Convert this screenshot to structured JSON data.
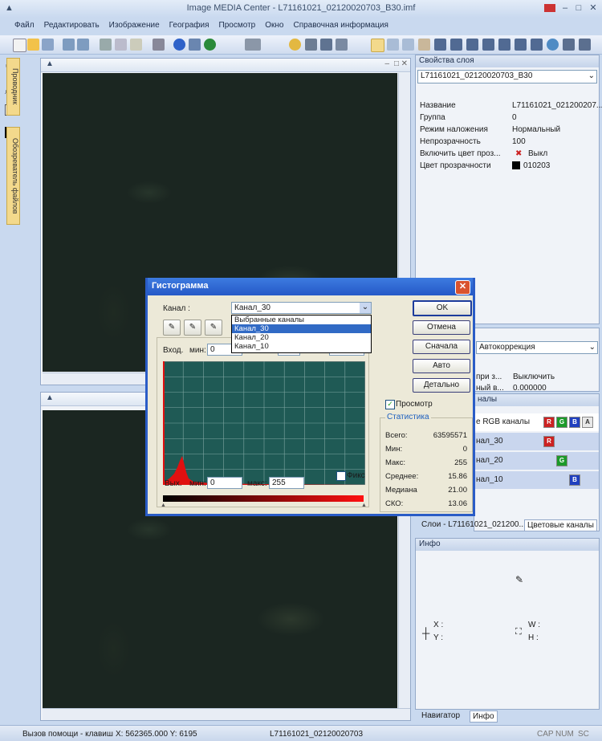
{
  "window": {
    "title": "Image MEDIA Center - L71161021_02120020703_B30.imf"
  },
  "menu": [
    "Файл",
    "Редактировать",
    "Изображение",
    "География",
    "Просмотр",
    "Окно",
    "Справочная информация"
  ],
  "left_tabs": [
    "Проводник",
    "Обозреватель файлов"
  ],
  "layer_props": {
    "title": "Свойства слоя",
    "layer_select": "L71161021_02120020703_B30",
    "rows": [
      {
        "key": "Название",
        "value": "L71161021_021200207..."
      },
      {
        "key": "Группа",
        "value": "0"
      },
      {
        "key": "Режим наложения",
        "value": "Нормальный"
      },
      {
        "key": "Непрозрачность",
        "value": "100"
      },
      {
        "key": "Включить цвет проз...",
        "value": "Выкл"
      },
      {
        "key": "Цвет прозрачности",
        "value": "010203"
      }
    ]
  },
  "autocorr": {
    "select": "Автокоррекция",
    "row1_key": "при з...",
    "row1_val": "Выключить",
    "row2_key": "ный в...",
    "row2_val": "0.000000"
  },
  "channels_panel": {
    "title": "налы",
    "rows": [
      {
        "label": "е RGB каналы"
      },
      {
        "label": "нал_30"
      },
      {
        "label": "нал_20"
      },
      {
        "label": "нал_10"
      }
    ],
    "tabs": [
      "Слои - L71161021_021200...",
      "Цветовые каналы"
    ]
  },
  "info_panel": {
    "title": "Инфо",
    "x_label": "X :",
    "y_label": "Y :",
    "w_label": "W :",
    "h_label": "H :",
    "tabs": [
      "Навигатор",
      "Инфо"
    ]
  },
  "dialog": {
    "title": "Гистограмма",
    "channel_label": "Канал :",
    "channel_value": "Канал_30",
    "channel_options": [
      "Выбранные каналы",
      "Канал_30",
      "Канал_20",
      "Канал_10"
    ],
    "input_label": "Вход.",
    "min_label": "мин:",
    "input_min": "0",
    "output_label": "Вых.",
    "output_min": "0",
    "max_label": "макс:",
    "output_max": "255",
    "fix_label": "Фикс",
    "preview_label": "Просмотр",
    "buttons": {
      "ok": "OK",
      "cancel": "Отмена",
      "reset": "Сначала",
      "auto": "Авто",
      "detail": "Детально"
    },
    "stats_title": "Статистика",
    "stats": [
      {
        "key": "Всего:",
        "value": "63595571"
      },
      {
        "key": "Мин:",
        "value": "0"
      },
      {
        "key": "Макс:",
        "value": "255"
      },
      {
        "key": "Среднее:",
        "value": "15.86"
      },
      {
        "key": "Медиана",
        "value": "21.00"
      },
      {
        "key": "СКО:",
        "value": "13.06"
      }
    ]
  },
  "status": {
    "help": "Вызов помощи - клавиш",
    "coords": "X: 562365.000  Y: 6195",
    "file": "L71161021_02120020703",
    "keys": [
      "CAP",
      "NUM",
      "SC"
    ]
  },
  "colors": {
    "histogram_bg": "#1f5a55",
    "histogram_bar": "#e01010",
    "accent": "#2a5cc7"
  }
}
